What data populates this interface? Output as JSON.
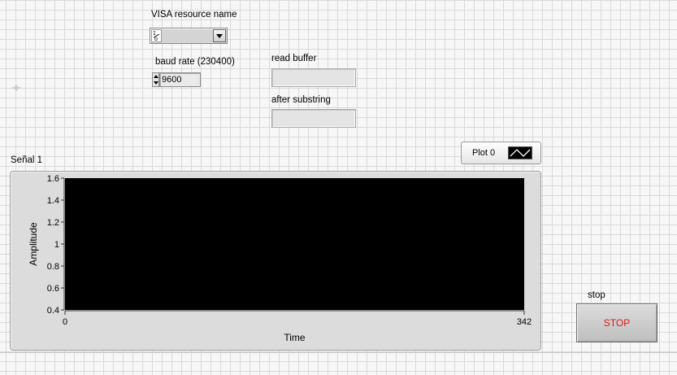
{
  "visa": {
    "label": "VISA resource name",
    "icon_glyph": "I/O",
    "value": ""
  },
  "baud": {
    "label": "baud rate (230400)",
    "value": "9600"
  },
  "read_buffer": {
    "label": "read buffer",
    "value": ""
  },
  "after_substring": {
    "label": "after substring",
    "value": ""
  },
  "legend": {
    "plot_name": "Plot 0"
  },
  "stop": {
    "label": "stop",
    "button_text": "STOP",
    "text_color": "#e01616"
  },
  "chart_data": {
    "type": "line",
    "title": "Señal 1",
    "xlabel": "Time",
    "ylabel": "Amplitude",
    "xlim": [
      0,
      342
    ],
    "ylim": [
      0.4,
      1.6
    ],
    "x_ticks": [
      "0",
      "342"
    ],
    "y_ticks": [
      "1.6",
      "1.4",
      "1.2",
      "1",
      "0.8",
      "0.6",
      "0.4"
    ],
    "series": [
      {
        "name": "Plot 0",
        "values": []
      }
    ],
    "background": "#000000",
    "legend_position": "top-right",
    "grid": false
  }
}
